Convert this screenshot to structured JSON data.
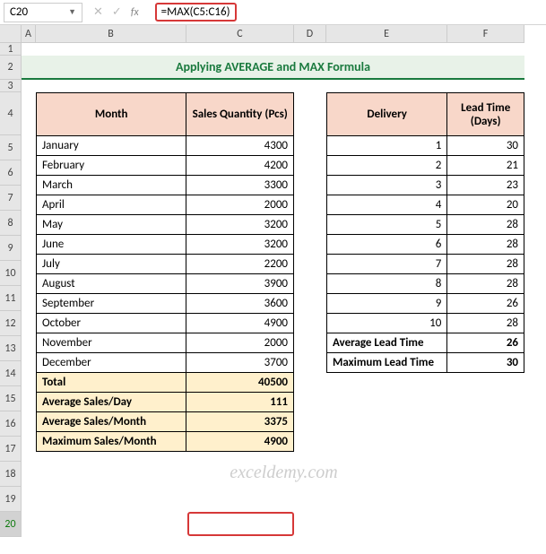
{
  "namebox": {
    "value": "C20"
  },
  "formula_bar": {
    "formula": "=MAX(C5:C16)"
  },
  "columns": [
    "A",
    "B",
    "C",
    "D",
    "E",
    "F"
  ],
  "rows": [
    "1",
    "2",
    "3",
    "4",
    "5",
    "6",
    "7",
    "8",
    "9",
    "10",
    "11",
    "12",
    "13",
    "14",
    "15",
    "16",
    "17",
    "18",
    "19",
    "20"
  ],
  "title": "Applying AVERAGE and MAX Formula",
  "left_table": {
    "headers": {
      "month": "Month",
      "qty": "Sales Quantity (Pcs)"
    },
    "rows": [
      {
        "month": "January",
        "qty": "4300"
      },
      {
        "month": "February",
        "qty": "4200"
      },
      {
        "month": "March",
        "qty": "3300"
      },
      {
        "month": "April",
        "qty": "2000"
      },
      {
        "month": "May",
        "qty": "3200"
      },
      {
        "month": "June",
        "qty": "3200"
      },
      {
        "month": "July",
        "qty": "2200"
      },
      {
        "month": "August",
        "qty": "3900"
      },
      {
        "month": "September",
        "qty": "3600"
      },
      {
        "month": "October",
        "qty": "4900"
      },
      {
        "month": "November",
        "qty": "2000"
      },
      {
        "month": "December",
        "qty": "3700"
      }
    ],
    "summary": {
      "total_label": "Total",
      "total_value": "40500",
      "avg_day_label": "Average Sales/Day",
      "avg_day_value": "111",
      "avg_month_label": "Average Sales/Month",
      "avg_month_value": "3375",
      "max_month_label": "Maximum Sales/Month",
      "max_month_value": "4900"
    }
  },
  "right_table": {
    "headers": {
      "delivery": "Delivery",
      "lead": "Lead Time (Days)"
    },
    "rows": [
      {
        "delivery": "1",
        "lead": "30"
      },
      {
        "delivery": "2",
        "lead": "21"
      },
      {
        "delivery": "3",
        "lead": "23"
      },
      {
        "delivery": "4",
        "lead": "20"
      },
      {
        "delivery": "5",
        "lead": "28"
      },
      {
        "delivery": "6",
        "lead": "28"
      },
      {
        "delivery": "7",
        "lead": "28"
      },
      {
        "delivery": "8",
        "lead": "28"
      },
      {
        "delivery": "9",
        "lead": "26"
      },
      {
        "delivery": "10",
        "lead": "28"
      }
    ],
    "summary": {
      "avg_label": "Average Lead Time",
      "avg_value": "26",
      "max_label": "Maximum Lead Time",
      "max_value": "30"
    }
  },
  "watermark": "exceldemy.com"
}
